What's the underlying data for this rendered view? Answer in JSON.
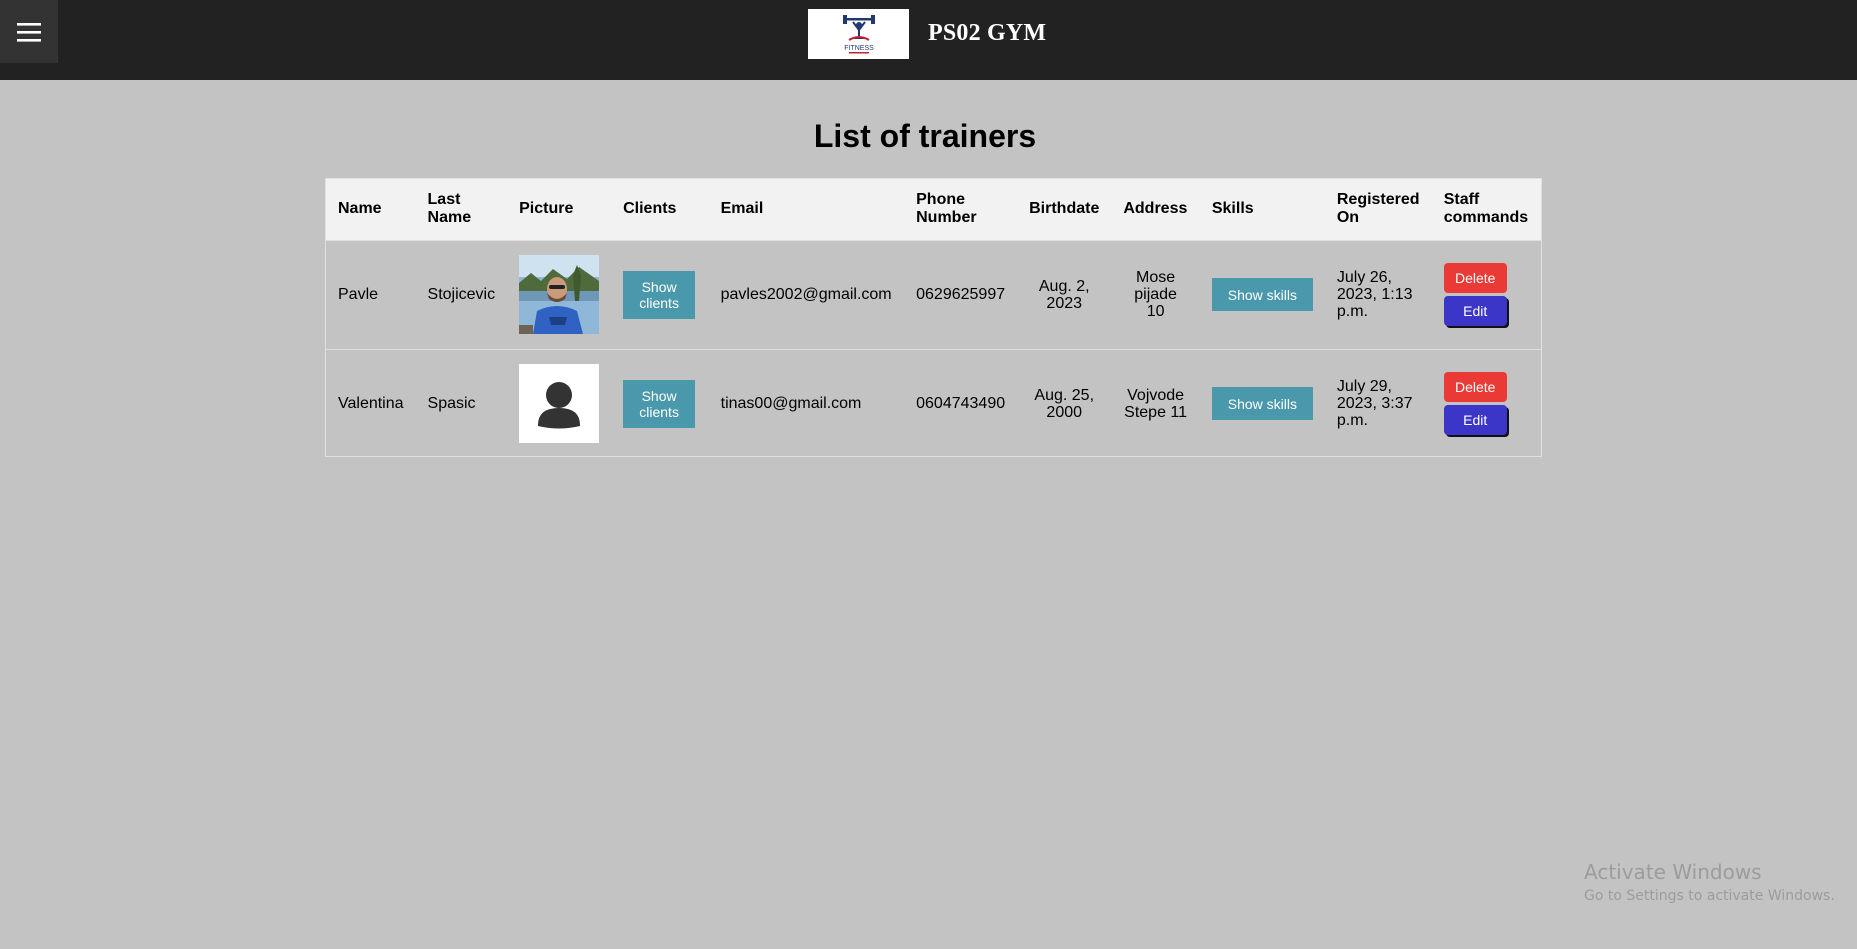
{
  "header": {
    "menu_icon": "hamburger-icon",
    "brand": "PS02 GYM",
    "logo_text": "FITNESS"
  },
  "page": {
    "title": "List of trainers"
  },
  "table": {
    "columns": [
      "Name",
      "Last Name",
      "Picture",
      "Clients",
      "Email",
      "Phone Number",
      "Birthdate",
      "Address",
      "Skills",
      "Registered On",
      "Staff commands"
    ],
    "rows": [
      {
        "name": "Pavle",
        "last_name": "Stojicevic",
        "picture": "trainer-photo",
        "clients_btn": "Show clients",
        "email": "pavles2002@gmail.com",
        "phone": "0629625997",
        "birthdate": "Aug. 2, 2023",
        "address": "Mose pijade 10",
        "skills_btn": "Show skills",
        "registered": "July 26, 2023, 1:13 p.m.",
        "delete_btn": "Delete",
        "edit_btn": "Edit"
      },
      {
        "name": "Valentina",
        "last_name": "Spasic",
        "picture": "default-avatar",
        "clients_btn": "Show clients",
        "email": "tinas00@gmail.com",
        "phone": "0604743490",
        "birthdate": "Aug. 25, 2000",
        "address": "Vojvode Stepe 11",
        "skills_btn": "Show skills",
        "registered": "July 29, 2023, 3:37 p.m.",
        "delete_btn": "Delete",
        "edit_btn": "Edit"
      }
    ]
  },
  "watermark": {
    "line1": "Activate Windows",
    "line2": "Go to Settings to activate Windows."
  },
  "colors": {
    "topbar": "#222222",
    "background": "#c3c3c3",
    "teal_button": "#4a98ab",
    "delete_button": "#ea3a35",
    "edit_button": "#3b35c8"
  }
}
